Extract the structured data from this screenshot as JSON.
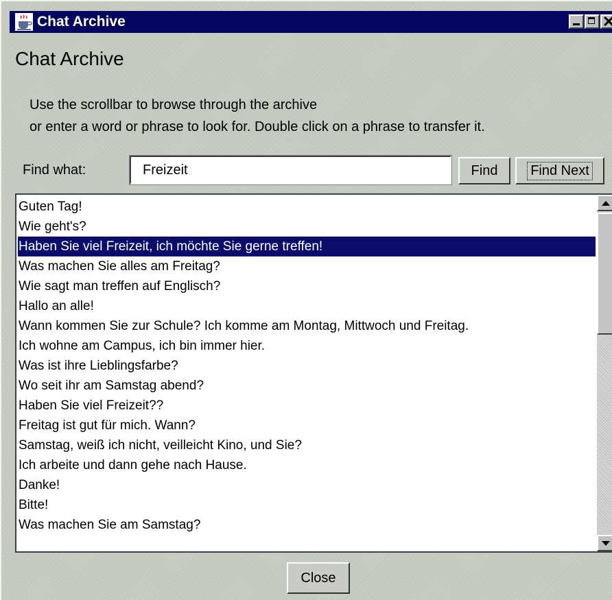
{
  "window": {
    "title": "Chat Archive",
    "icon": "java-coffee-cup-icon",
    "controls": [
      "minimize-icon",
      "maximize-icon",
      "close-icon"
    ]
  },
  "heading": "Chat Archive",
  "instructions": {
    "line1": "Use the scrollbar to browse through the archive",
    "line2": "or enter a word or phrase to look for. Double click on a phrase to transfer it."
  },
  "find": {
    "label": "Find what:",
    "value": "Freizeit",
    "find_button": "Find",
    "find_next_button": "Find Next"
  },
  "archive": {
    "selected_index": 2,
    "items": [
      "Guten Tag!",
      "Wie geht's?",
      "Haben Sie viel Freizeit, ich möchte Sie gerne treffen!",
      "Was machen Sie alles am Freitag?",
      "Wie sagt man treffen auf Englisch?",
      "Hallo an alle!",
      "Wann kommen Sie zur Schule? Ich komme am Montag, Mittwoch und Freitag.",
      "Ich wohne am Campus, ich bin immer hier.",
      "Was ist ihre Lieblingsfarbe?",
      "Wo seit ihr am Samstag abend?",
      "Haben Sie viel Freizeit??",
      "Freitag ist gut für mich. Wann?",
      "Samstag, weiß ich nicht, veilleicht Kino, und Sie?",
      "Ich arbeite und dann gehe nach Hause.",
      "Danke!",
      "Bitte!",
      "Was machen Sie am Samstag?"
    ]
  },
  "footer": {
    "close_button": "Close"
  },
  "colors": {
    "titlebar": "#05065f",
    "selection": "#0b0c6b",
    "background": "#c8cdc4"
  }
}
